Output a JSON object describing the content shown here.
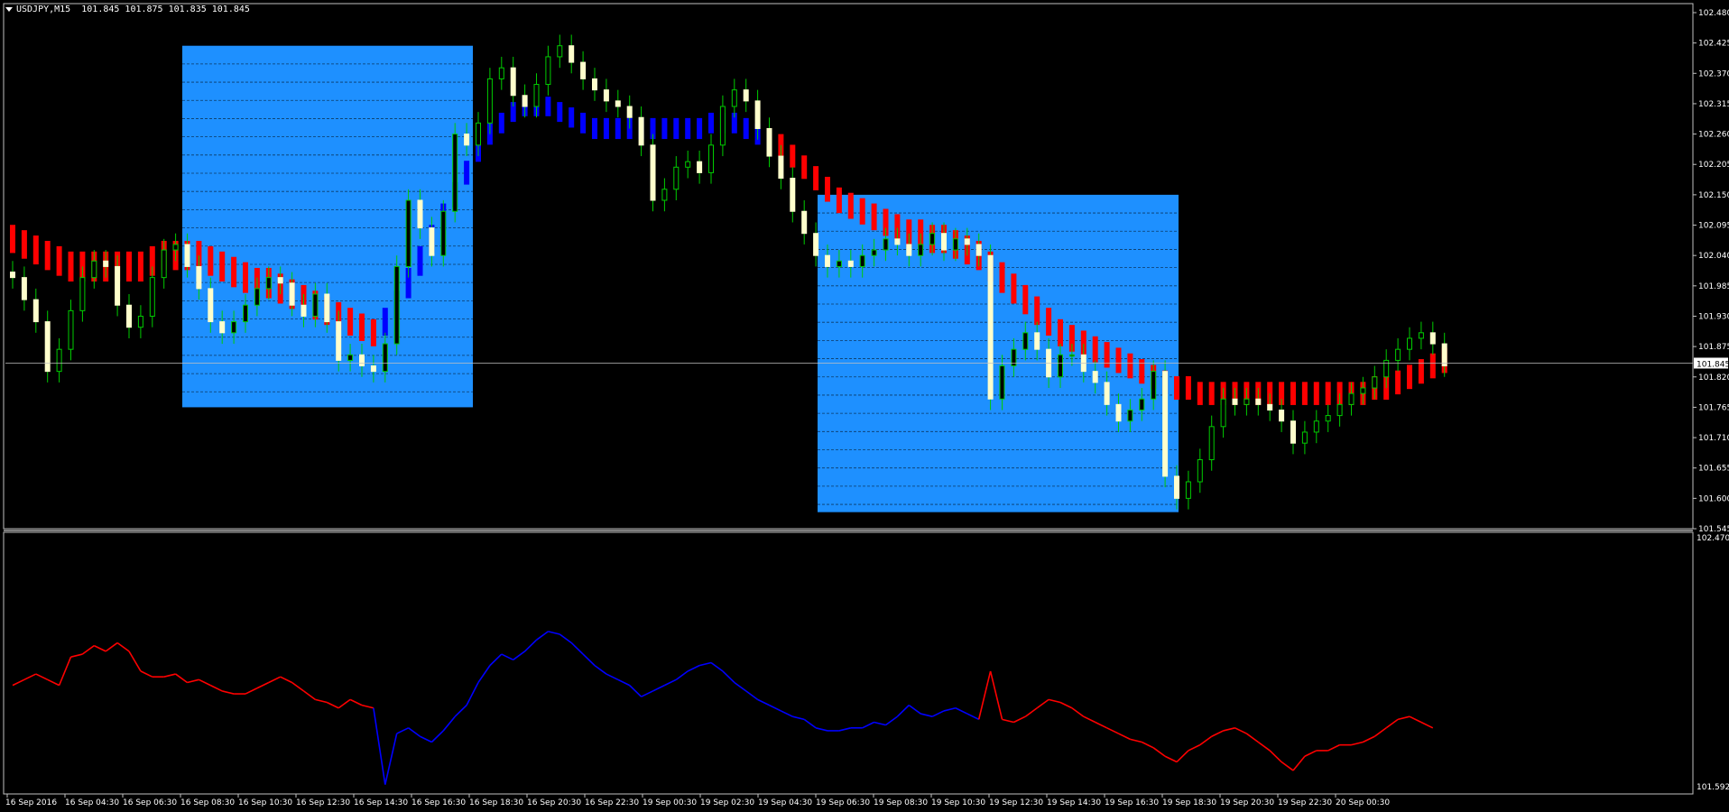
{
  "header": {
    "title": "USDJPY,M15",
    "quote": "101.845 101.875 101.835 101.845"
  },
  "colors": {
    "background": "#000000",
    "frame": "#c0c0c0",
    "candle_bull": "#ffffcc",
    "wick": "#00cc00",
    "band_down": "#ff0000",
    "band_up": "#0000ff",
    "box": "#1e90ff"
  },
  "icons": {
    "menu": "caret-down-icon"
  },
  "chart_data": [
    {
      "type": "candlestick",
      "title": "",
      "symbol": "USDJPY",
      "timeframe": "M15",
      "last_price": "101.845",
      "ylim": [
        101.545,
        102.48
      ],
      "y_ticks": [
        "102.480",
        "102.425",
        "102.370",
        "102.315",
        "102.260",
        "102.205",
        "102.150",
        "102.095",
        "102.040",
        "101.985",
        "101.930",
        "101.875",
        "101.820",
        "101.765",
        "101.710",
        "101.655",
        "101.600",
        "101.545"
      ],
      "x_ticks": [
        "16 Sep 2016",
        "16 Sep 04:30",
        "16 Sep 06:30",
        "16 Sep 08:30",
        "16 Sep 10:30",
        "16 Sep 12:30",
        "16 Sep 14:30",
        "16 Sep 16:30",
        "16 Sep 18:30",
        "16 Sep 20:30",
        "16 Sep 22:30",
        "19 Sep 00:30",
        "19 Sep 02:30",
        "19 Sep 04:30",
        "19 Sep 06:30",
        "19 Sep 08:30",
        "19 Sep 10:30",
        "19 Sep 12:30",
        "19 Sep 14:30",
        "19 Sep 16:30",
        "19 Sep 18:30",
        "19 Sep 20:30",
        "19 Sep 22:30",
        "20 Sep 00:30"
      ],
      "close_series": [
        102.0,
        101.96,
        101.92,
        101.83,
        101.87,
        101.94,
        102.0,
        102.03,
        102.02,
        101.95,
        101.91,
        101.93,
        102.0,
        102.05,
        102.06,
        102.02,
        101.98,
        101.92,
        101.9,
        101.92,
        101.95,
        101.98,
        102.0,
        101.99,
        101.95,
        101.93,
        101.97,
        101.92,
        101.85,
        101.86,
        101.84,
        101.83,
        101.88,
        102.02,
        102.14,
        102.09,
        102.04,
        102.12,
        102.26,
        102.24,
        102.28,
        102.36,
        102.38,
        102.33,
        102.31,
        102.35,
        102.4,
        102.42,
        102.39,
        102.36,
        102.34,
        102.32,
        102.31,
        102.29,
        102.24,
        102.14,
        102.16,
        102.2,
        102.21,
        102.19,
        102.24,
        102.31,
        102.34,
        102.32,
        102.27,
        102.22,
        102.18,
        102.12,
        102.08,
        102.04,
        102.02,
        102.03,
        102.02,
        102.04,
        102.05,
        102.07,
        102.06,
        102.04,
        102.06,
        102.08,
        102.05,
        102.07,
        102.06,
        102.04,
        101.78,
        101.84,
        101.87,
        101.9,
        101.87,
        101.82,
        101.86,
        101.86,
        101.83,
        101.81,
        101.77,
        101.74,
        101.76,
        101.78,
        101.83,
        101.64,
        101.6,
        101.63,
        101.67,
        101.73,
        101.78,
        101.77,
        101.78,
        101.77,
        101.76,
        101.74,
        101.7,
        101.72,
        101.74,
        101.75,
        101.77,
        101.79,
        101.8,
        101.82,
        101.85,
        101.87,
        101.89,
        101.9,
        101.88,
        101.84
      ],
      "band_series": [
        102.07,
        102.06,
        102.05,
        102.04,
        102.03,
        102.02,
        102.02,
        102.02,
        102.02,
        102.02,
        102.02,
        102.02,
        102.03,
        102.04,
        102.04,
        102.04,
        102.04,
        102.03,
        102.02,
        102.01,
        102.0,
        101.99,
        101.99,
        101.98,
        101.97,
        101.96,
        101.95,
        101.94,
        101.93,
        101.92,
        101.91,
        101.9,
        101.92,
        101.95,
        101.99,
        102.03,
        102.07,
        102.11,
        102.15,
        102.19,
        102.23,
        102.26,
        102.28,
        102.3,
        102.31,
        102.31,
        102.31,
        102.3,
        102.29,
        102.28,
        102.27,
        102.27,
        102.27,
        102.27,
        102.27,
        102.27,
        102.27,
        102.27,
        102.27,
        102.27,
        102.28,
        102.28,
        102.28,
        102.27,
        102.26,
        102.25,
        102.24,
        102.22,
        102.2,
        102.18,
        102.16,
        102.14,
        102.13,
        102.12,
        102.11,
        102.1,
        102.09,
        102.08,
        102.08,
        102.07,
        102.07,
        102.06,
        102.05,
        102.04,
        102.02,
        102.0,
        101.98,
        101.96,
        101.94,
        101.92,
        101.9,
        101.89,
        101.88,
        101.87,
        101.86,
        101.85,
        101.84,
        101.83,
        101.82,
        101.81,
        101.8,
        101.8,
        101.79,
        101.79,
        101.79,
        101.79,
        101.79,
        101.79,
        101.79,
        101.79,
        101.79,
        101.79,
        101.79,
        101.79,
        101.79,
        101.79,
        101.79,
        101.8,
        101.8,
        101.81,
        101.82,
        101.83,
        101.84,
        101.85
      ],
      "band_trend": [
        "down",
        "down",
        "down",
        "down",
        "down",
        "down",
        "down",
        "down",
        "down",
        "down",
        "down",
        "down",
        "down",
        "down",
        "down",
        "down",
        "down",
        "down",
        "down",
        "down",
        "down",
        "down",
        "down",
        "down",
        "down",
        "down",
        "down",
        "down",
        "down",
        "down",
        "down",
        "down",
        "up",
        "up",
        "up",
        "up",
        "up",
        "up",
        "up",
        "up",
        "up",
        "up",
        "up",
        "up",
        "up",
        "up",
        "up",
        "up",
        "up",
        "up",
        "up",
        "up",
        "up",
        "up",
        "up",
        "up",
        "up",
        "up",
        "up",
        "up",
        "up",
        "up",
        "up",
        "up",
        "up",
        "down",
        "down",
        "down",
        "down",
        "down",
        "down",
        "down",
        "down",
        "down",
        "down",
        "down",
        "down",
        "down",
        "down",
        "down",
        "down",
        "down",
        "down",
        "down",
        "down",
        "down",
        "down",
        "down",
        "down",
        "down",
        "down",
        "down",
        "down",
        "down",
        "down",
        "down",
        "down",
        "down",
        "down",
        "down",
        "down",
        "down",
        "down",
        "down",
        "down",
        "down",
        "down",
        "down",
        "down",
        "down",
        "down",
        "down",
        "down",
        "down",
        "down",
        "down",
        "down",
        "down",
        "down",
        "down",
        "down",
        "down",
        "down",
        "down"
      ],
      "boxes": [
        {
          "start": "16 Sep 08:30",
          "end": "16 Sep 18:30",
          "high": 102.42,
          "low": 101.765
        },
        {
          "start": "19 Sep 06:30",
          "end": "19 Sep 18:30",
          "high": 102.15,
          "low": 101.575
        }
      ],
      "grid": false
    },
    {
      "type": "line",
      "title": "",
      "ylim": [
        101.5926,
        102.4704
      ],
      "y_ticks": [
        "102.4704",
        "101.5926"
      ],
      "values": [
        101.95,
        101.97,
        101.99,
        101.97,
        101.95,
        102.05,
        102.06,
        102.09,
        102.07,
        102.1,
        102.07,
        102.0,
        101.98,
        101.98,
        101.99,
        101.96,
        101.97,
        101.95,
        101.93,
        101.92,
        101.92,
        101.94,
        101.96,
        101.98,
        101.96,
        101.93,
        101.9,
        101.89,
        101.87,
        101.9,
        101.88,
        101.87,
        101.6,
        101.78,
        101.8,
        101.77,
        101.75,
        101.79,
        101.84,
        101.88,
        101.96,
        102.02,
        102.06,
        102.04,
        102.07,
        102.11,
        102.14,
        102.13,
        102.1,
        102.06,
        102.02,
        101.99,
        101.97,
        101.95,
        101.91,
        101.93,
        101.95,
        101.97,
        102.0,
        102.02,
        102.03,
        102.0,
        101.96,
        101.93,
        101.9,
        101.88,
        101.86,
        101.84,
        101.83,
        101.8,
        101.79,
        101.79,
        101.8,
        101.8,
        101.82,
        101.81,
        101.84,
        101.88,
        101.85,
        101.84,
        101.86,
        101.87,
        101.85,
        101.83,
        102.0,
        101.83,
        101.82,
        101.84,
        101.87,
        101.9,
        101.89,
        101.87,
        101.84,
        101.82,
        101.8,
        101.78,
        101.76,
        101.75,
        101.73,
        101.7,
        101.68,
        101.72,
        101.74,
        101.77,
        101.79,
        101.8,
        101.78,
        101.75,
        101.72,
        101.68,
        101.65,
        101.7,
        101.72,
        101.72,
        101.74,
        101.74,
        101.75,
        101.77,
        101.8,
        101.83,
        101.84,
        101.82,
        101.8
      ],
      "trend": [
        "down",
        "down",
        "down",
        "down",
        "down",
        "down",
        "down",
        "down",
        "down",
        "down",
        "down",
        "down",
        "down",
        "down",
        "down",
        "down",
        "down",
        "down",
        "down",
        "down",
        "down",
        "down",
        "down",
        "down",
        "down",
        "down",
        "down",
        "down",
        "down",
        "down",
        "down",
        "down",
        "up",
        "up",
        "up",
        "up",
        "up",
        "up",
        "up",
        "up",
        "up",
        "up",
        "up",
        "up",
        "up",
        "up",
        "up",
        "up",
        "up",
        "up",
        "up",
        "up",
        "up",
        "up",
        "up",
        "up",
        "up",
        "up",
        "up",
        "up",
        "up",
        "up",
        "up",
        "up",
        "up",
        "up",
        "up",
        "up",
        "up",
        "up",
        "up",
        "up",
        "up",
        "up",
        "up",
        "up",
        "up",
        "up",
        "up",
        "up",
        "up",
        "up",
        "up",
        "up",
        "down",
        "down",
        "down",
        "down",
        "down",
        "down",
        "down",
        "down",
        "down",
        "down",
        "down",
        "down",
        "down",
        "down",
        "down",
        "down",
        "down",
        "down",
        "down",
        "down",
        "down",
        "down",
        "down",
        "down",
        "down",
        "down",
        "down",
        "down",
        "down",
        "down",
        "down",
        "down",
        "down",
        "down",
        "down",
        "down",
        "down",
        "down",
        "down",
        "down"
      ]
    }
  ]
}
